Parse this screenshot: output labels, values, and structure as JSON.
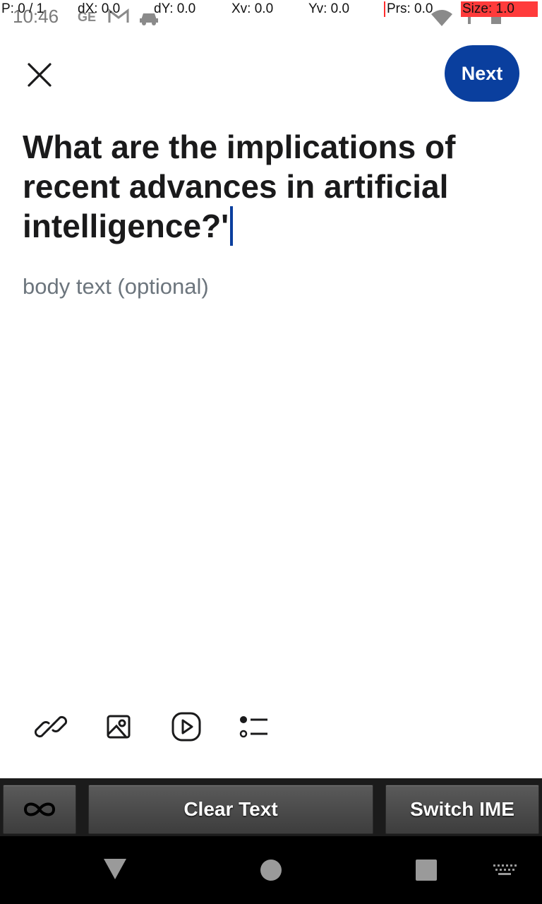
{
  "status_bar": {
    "time": "10:46",
    "debug": {
      "pointer": "P: 0 / 1",
      "dx": "dX: 0.0",
      "dy": "dY: 0.0",
      "xv": "Xv: 0.0",
      "yv": "Yv: 0.0",
      "prs": "Prs: 0.0",
      "size": "Size: 1.0"
    }
  },
  "header": {
    "next_label": "Next"
  },
  "editor": {
    "title_value": "What are the implications of recent advances in artificial intelligence?'",
    "body_placeholder": "body text (optional)"
  },
  "toolbar": {
    "icons": [
      "link-icon",
      "image-icon",
      "video-icon",
      "list-icon"
    ]
  },
  "ime_bar": {
    "clear_label": "Clear Text",
    "switch_label": "Switch IME"
  },
  "colors": {
    "accent": "#0a3f9e",
    "placeholder": "#6c757d"
  }
}
